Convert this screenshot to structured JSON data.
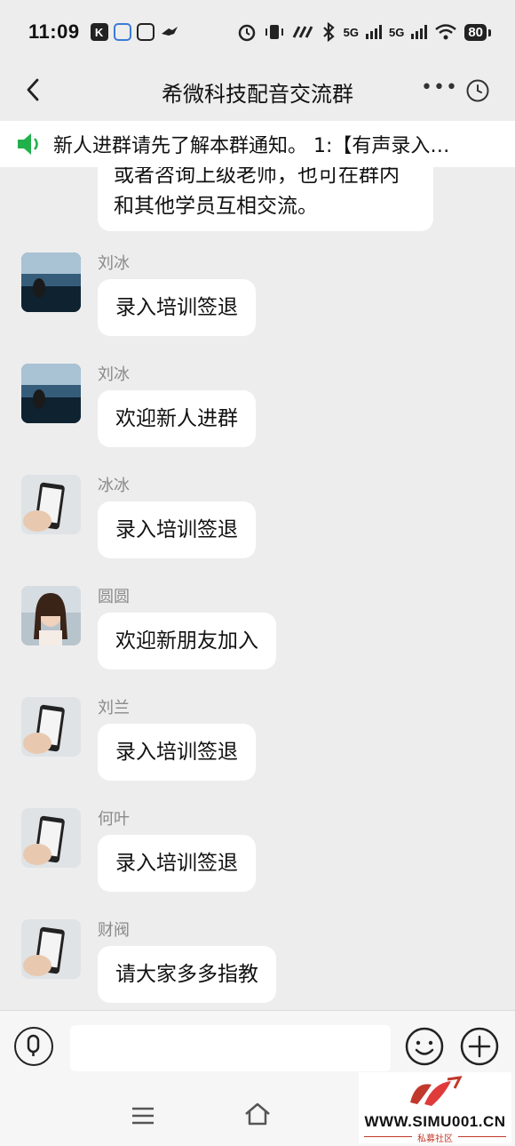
{
  "status_bar": {
    "time": "11:09",
    "battery": "80",
    "signal_1": "5G",
    "signal_2": "5G"
  },
  "header": {
    "title": "希微科技配音交流群",
    "more_icon": "more-dots-icon",
    "history_icon": "clock-icon"
  },
  "notice": {
    "icon": "speaker-icon",
    "text": "新人进群请先了解本群通知。 1:【有声录入…"
  },
  "chat": {
    "previous_message": "或者咨询上级老师，也可在群内和其他学员互相交流。",
    "messages": [
      {
        "sender": "刘冰",
        "text": "录入培训签退"
      },
      {
        "sender": "刘冰",
        "text": "欢迎新人进群"
      },
      {
        "sender": "冰冰",
        "text": " 录入培训签退"
      },
      {
        "sender": "圆圆",
        "text": "欢迎新朋友加入"
      },
      {
        "sender": "刘兰",
        "text": "录入培训签退"
      },
      {
        "sender": "何叶",
        "text": "录入培训签退"
      },
      {
        "sender": "财阀",
        "text": "请大家多多指教"
      }
    ]
  },
  "input_bar": {
    "placeholder": "",
    "voice_icon": "microphone-icon",
    "emoji_icon": "smiley-icon",
    "plus_icon": "plus-icon"
  },
  "watermark": {
    "text": "WWW.SIMU001.CN",
    "subtext": "私募社区"
  },
  "colors": {
    "background": "#ededed",
    "bubble": "#ffffff",
    "notice_speaker": "#21b04b",
    "sender_name": "#8a8a8a",
    "watermark_red": "#c0392b"
  }
}
